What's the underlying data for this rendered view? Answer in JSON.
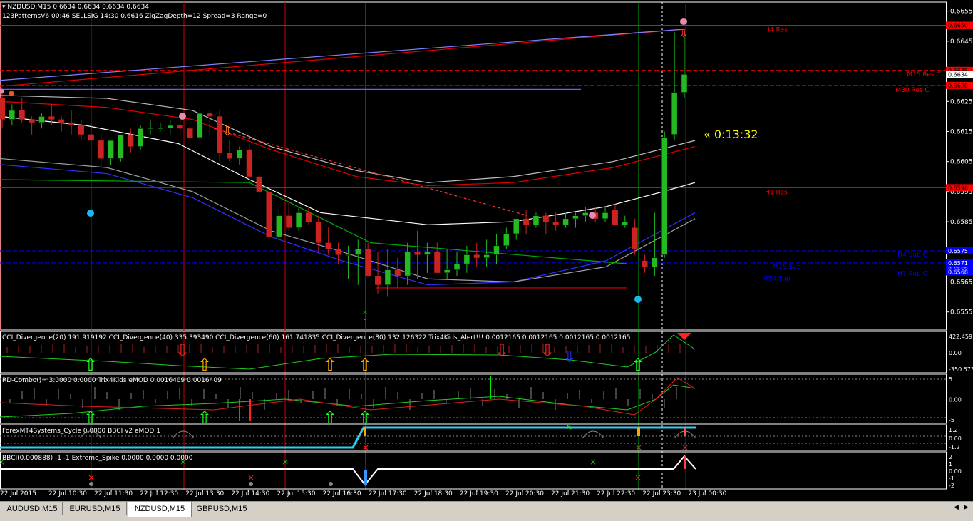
{
  "header": {
    "symbol_line": "NZDUSD,M15  0.6634 0.6634 0.6634 0.6634",
    "indicator_line": "123PatternsV6  00:46  SELLSIG  14:30  0.6616  ZigZagDepth=12  Spread=3  Range=0"
  },
  "timer": "« 0:13:32",
  "price_axis": {
    "ticks": [
      "0.6655",
      "0.6645",
      "0.6635",
      "0.6625",
      "0.6615",
      "0.6605",
      "0.6595",
      "0.6585",
      "0.6575",
      "0.6565",
      "0.6555"
    ],
    "tags": [
      {
        "text": "0.6650",
        "bg": "#ff0000",
        "fg": "#000000"
      },
      {
        "text": "0.6635",
        "bg": "#ff0000",
        "fg": "#000000"
      },
      {
        "text": "0.6634",
        "bg": "#ffffff",
        "fg": "#000000"
      },
      {
        "text": "0.6630",
        "bg": "#ff0000",
        "fg": "#000000"
      },
      {
        "text": "0.6596",
        "bg": "#ff0000",
        "fg": "#000000"
      },
      {
        "text": "0.6575",
        "bg": "#0000ff",
        "fg": "#ffffff"
      },
      {
        "text": "0.6571",
        "bg": "#0000ff",
        "fg": "#ffffff"
      },
      {
        "text": "0.6569",
        "bg": "#0000ff",
        "fg": "#ffffff"
      },
      {
        "text": "0.6568",
        "bg": "#0000ff",
        "fg": "#ffffff"
      }
    ]
  },
  "levels": [
    {
      "label": "H4 Res",
      "price": 0.66503,
      "color": "#ff0000"
    },
    {
      "label": "M15 Res C",
      "price": 0.66353,
      "color": "#ff0000"
    },
    {
      "label": "M30 Res C",
      "price": 0.66303,
      "color": "#ff0000"
    },
    {
      "label": "H1 Res",
      "price": 0.65963,
      "color": "#ff0000"
    },
    {
      "label": "H4 Sup C",
      "price": 0.65753,
      "color": "#0000ff"
    },
    {
      "label": "M15 Sup",
      "price": 0.65713,
      "color": "#0000ff"
    },
    {
      "label": "H1 Sup C",
      "price": 0.65693,
      "color": "#0000ff"
    },
    {
      "label": "M30 Sup",
      "price": 0.65683,
      "color": "#0000ff"
    }
  ],
  "time_axis": [
    "22 Jul 2015",
    "22 Jul 10:30",
    "22 Jul 11:30",
    "22 Jul 12:30",
    "22 Jul 13:30",
    "22 Jul 14:30",
    "22 Jul 15:30",
    "22 Jul 16:30",
    "22 Jul 17:30",
    "22 Jul 18:30",
    "22 Jul 19:30",
    "22 Jul 20:30",
    "22 Jul 21:30",
    "22 Jul 22:30",
    "22 Jul 23:30",
    "23 Jul 00:30"
  ],
  "subwindows": [
    {
      "label": "CCI_Divergence(20) 191.919192  CCI_Divergence(40) 335.393490  CCI_Divergence(60) 161.741835  CCI_Divergence(80) 132.126322  Trix4Kids_Alert!!! 0.0012165 0.0012165 0.0012165 0.0012165",
      "scale": [
        "422.459",
        "0.00",
        "-350.573"
      ]
    },
    {
      "label": "RD-Combo()=  3.0000 0.0000  Trix4Kids eMOD 0.0016409 0.0016409",
      "scale": [
        "5",
        "0.00",
        "-5"
      ]
    },
    {
      "label": "ForexMT4Systems_Cycle 0.0000  BBCI v2 eMOD 1",
      "scale": [
        "1.2",
        "0.00",
        "-1.2"
      ]
    },
    {
      "label": "BBCI(0.000888) -1 -1  Extreme_Spike 0.0000 0.0000 0.0000",
      "scale": [
        "2",
        "1",
        "0.00",
        "-1",
        "-2"
      ]
    }
  ],
  "tabs": [
    "AUDUSD,M15",
    "EURUSD,M15",
    "NZDUSD,M15",
    "GBPUSD,M15"
  ],
  "active_tab": "NZDUSD,M15",
  "chart_data": {
    "type": "candlestick",
    "timeframe": "M15",
    "candles": [
      [
        0.6626,
        0.6628,
        0.6616,
        0.6619
      ],
      [
        0.6619,
        0.6624,
        0.6617,
        0.6622
      ],
      [
        0.6622,
        0.6626,
        0.6618,
        0.6619
      ],
      [
        0.6619,
        0.662,
        0.6614,
        0.6618
      ],
      [
        0.6618,
        0.6621,
        0.6616,
        0.662
      ],
      [
        0.662,
        0.6624,
        0.6617,
        0.6619
      ],
      [
        0.6619,
        0.662,
        0.6615,
        0.6618
      ],
      [
        0.6618,
        0.6622,
        0.6614,
        0.6617
      ],
      [
        0.6617,
        0.6619,
        0.6612,
        0.6614
      ],
      [
        0.6614,
        0.6618,
        0.6612,
        0.6612
      ],
      [
        0.6612,
        0.6614,
        0.6603,
        0.6606
      ],
      [
        0.6606,
        0.6612,
        0.6604,
        0.6612
      ],
      [
        0.6606,
        0.6614,
        0.6605,
        0.6614
      ],
      [
        0.6614,
        0.6616,
        0.6608,
        0.661
      ],
      [
        0.661,
        0.6617,
        0.6609,
        0.6616
      ],
      [
        0.6616,
        0.6619,
        0.6614,
        0.6616
      ],
      [
        0.6616,
        0.6618,
        0.6615,
        0.6616
      ],
      [
        0.6616,
        0.6619,
        0.6614,
        0.6617
      ],
      [
        0.6617,
        0.662,
        0.6614,
        0.6616
      ],
      [
        0.6616,
        0.6618,
        0.6611,
        0.6613
      ],
      [
        0.6613,
        0.6623,
        0.6612,
        0.6621
      ],
      [
        0.6621,
        0.6622,
        0.6614,
        0.662
      ],
      [
        0.662,
        0.6622,
        0.6605,
        0.6608
      ],
      [
        0.6608,
        0.6612,
        0.6605,
        0.6606
      ],
      [
        0.6606,
        0.661,
        0.6604,
        0.6609
      ],
      [
        0.6609,
        0.6611,
        0.6598,
        0.66
      ],
      [
        0.66,
        0.6601,
        0.6592,
        0.6595
      ],
      [
        0.6595,
        0.6597,
        0.6578,
        0.658
      ],
      [
        0.658,
        0.6589,
        0.6579,
        0.6587
      ],
      [
        0.6587,
        0.6592,
        0.6582,
        0.6583
      ],
      [
        0.6583,
        0.659,
        0.6582,
        0.6588
      ],
      [
        0.6588,
        0.659,
        0.6584,
        0.6585
      ],
      [
        0.6585,
        0.6587,
        0.6575,
        0.6578
      ],
      [
        0.6578,
        0.6583,
        0.6574,
        0.6576
      ],
      [
        0.6576,
        0.6578,
        0.6571,
        0.6574
      ],
      [
        0.6574,
        0.6577,
        0.6566,
        0.6574
      ],
      [
        0.6574,
        0.6579,
        0.6564,
        0.6576
      ],
      [
        0.6576,
        0.6578,
        0.6567,
        0.6567
      ],
      [
        0.6567,
        0.6575,
        0.6561,
        0.6564
      ],
      [
        0.6564,
        0.6576,
        0.656,
        0.6569
      ],
      [
        0.6569,
        0.6573,
        0.6563,
        0.6567
      ],
      [
        0.6567,
        0.6578,
        0.6564,
        0.6575
      ],
      [
        0.6575,
        0.6582,
        0.6566,
        0.6574
      ],
      [
        0.6574,
        0.6578,
        0.6568,
        0.6575
      ],
      [
        0.6575,
        0.6578,
        0.6569,
        0.6568
      ],
      [
        0.6568,
        0.6576,
        0.6566,
        0.6569
      ],
      [
        0.6569,
        0.6575,
        0.6567,
        0.6571
      ],
      [
        0.6571,
        0.6577,
        0.6568,
        0.6574
      ],
      [
        0.6574,
        0.6578,
        0.657,
        0.6573
      ],
      [
        0.6573,
        0.6579,
        0.657,
        0.6574
      ],
      [
        0.6574,
        0.6581,
        0.6571,
        0.6577
      ],
      [
        0.6577,
        0.6583,
        0.6576,
        0.6581
      ],
      [
        0.6581,
        0.6586,
        0.6579,
        0.6586
      ],
      [
        0.6586,
        0.6589,
        0.6581,
        0.6584
      ],
      [
        0.6584,
        0.6588,
        0.6583,
        0.6587
      ],
      [
        0.6587,
        0.6588,
        0.6581,
        0.6585
      ],
      [
        0.6585,
        0.6588,
        0.6582,
        0.6584
      ],
      [
        0.6584,
        0.6588,
        0.6583,
        0.6586
      ],
      [
        0.6586,
        0.6588,
        0.6583,
        0.6587
      ],
      [
        0.6587,
        0.659,
        0.6585,
        0.6588
      ],
      [
        0.6588,
        0.659,
        0.6585,
        0.6586
      ],
      [
        0.6586,
        0.659,
        0.6585,
        0.6588
      ],
      [
        0.6589,
        0.6591,
        0.6584,
        0.6584
      ],
      [
        0.6584,
        0.6587,
        0.6583,
        0.6585
      ],
      [
        0.6583,
        0.6586,
        0.6574,
        0.6576
      ],
      [
        0.6572,
        0.6574,
        0.6568,
        0.657
      ],
      [
        0.657,
        0.6588,
        0.6567,
        0.6573
      ],
      [
        0.6574,
        0.6615,
        0.6573,
        0.6613
      ],
      [
        0.6614,
        0.6648,
        0.6612,
        0.6628
      ],
      [
        0.6628,
        0.6648,
        0.6626,
        0.6634
      ]
    ],
    "ylim": [
      0.6549,
      0.6658
    ]
  }
}
